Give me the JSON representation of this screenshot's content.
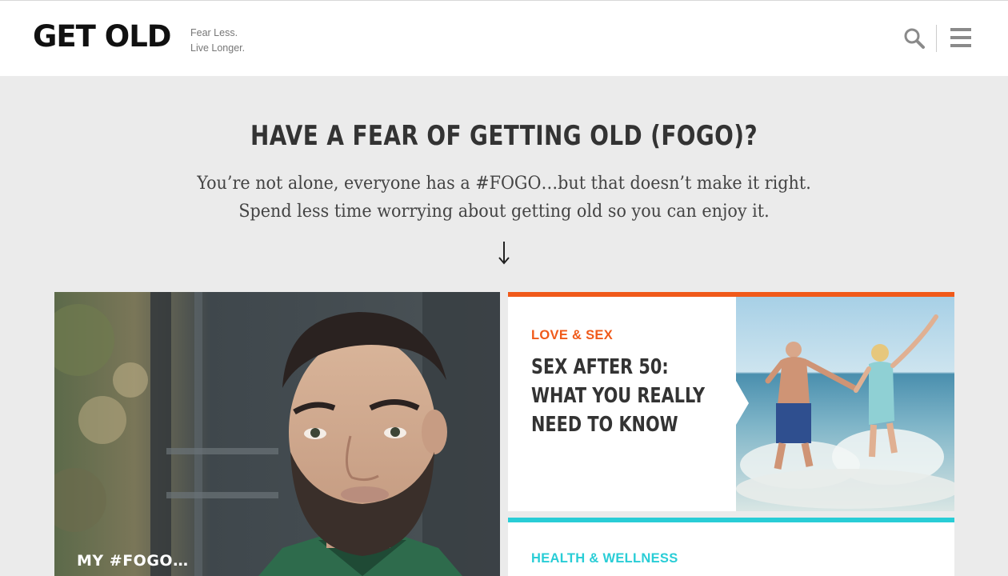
{
  "header": {
    "logo": "GET OLD",
    "tagline_line1": "Fear Less.",
    "tagline_line2": "Live Longer.",
    "search_icon": "search-icon",
    "menu_icon": "hamburger-menu-icon"
  },
  "hero": {
    "title": "HAVE A FEAR OF GETTING OLD (FOGO)?",
    "subtitle_line1": "You’re not alone, everyone has a #FOGO…but that doesn’t make it right.",
    "subtitle_line2": "Spend less time worrying about getting old so you can enjoy it.",
    "arrow_icon": "arrow-down-icon"
  },
  "feature": {
    "label": "MY #FOGO…"
  },
  "cards": [
    {
      "category": "LOVE & SEX",
      "headline_line1": "SEX AFTER 50:",
      "headline_line2": "WHAT YOU REALLY",
      "headline_line3": "NEED TO KNOW",
      "accent": "#f05a1a"
    },
    {
      "category": "HEALTH & WELLNESS",
      "accent": "#29cdd6"
    }
  ],
  "colors": {
    "background": "#ebebeb",
    "text_dark": "#333333",
    "orange": "#f05a1a",
    "teal": "#29cdd6"
  }
}
